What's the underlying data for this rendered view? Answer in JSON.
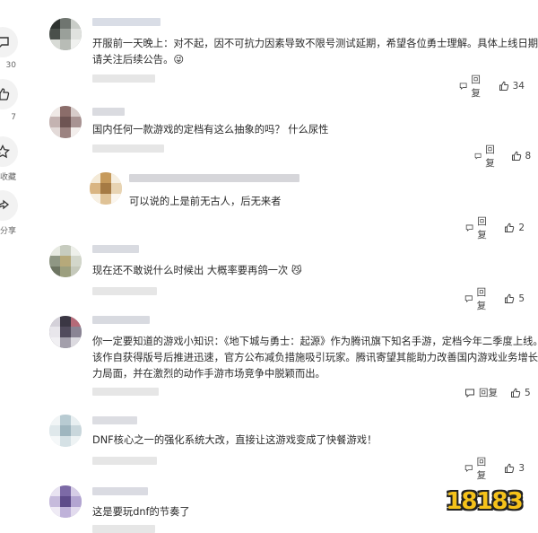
{
  "sidebar": {
    "comment": {
      "count": "30",
      "icon": "comment-icon"
    },
    "like": {
      "count": "7",
      "icon": "thumbs-up-icon"
    },
    "favorite": {
      "label": "收藏",
      "icon": "star-icon"
    },
    "share": {
      "label": "分享",
      "icon": "share-icon"
    }
  },
  "comments": [
    {
      "lines": [
        "开服前一天晚上：对不起，因不可抗力因素导致不限号测试延期，希望各位勇士理解。具体上线日期，",
        "请关注后续公告。😜"
      ],
      "reply_label": "回复",
      "likes": "34"
    },
    {
      "lines": [
        "国内任何一款游戏的定档有这么抽象的吗？ 什么尿性"
      ],
      "reply_label": "回复",
      "likes": "8"
    },
    {
      "lines": [
        "可以说的上是前无古人，后无来者"
      ],
      "reply_label": "回复",
      "likes": "2"
    },
    {
      "lines": [
        "现在还不敢说什么时候出 大概率要再鸽一次 😼"
      ],
      "reply_label": "回复",
      "likes": "5"
    },
    {
      "lines": [
        "你一定要知道的游戏小知识：《地下城与勇士：起源》作为腾讯旗下知名手游，定档今年二季度上线。",
        "该作自获得版号后推进迅速，官方公布减负措施吸引玩家。腾讯寄望其能助力改善国内游戏业务增长乏",
        "力局面，并在激烈的动作手游市场竞争中脱颖而出。"
      ],
      "reply_label": "回复",
      "likes": "5"
    },
    {
      "lines": [
        "DNF核心之一的强化系统大改，直接让这游戏变成了快餐游戏！"
      ],
      "reply_label": "回复",
      "likes": "3"
    },
    {
      "lines": [
        "这是要玩dnf的节奏了"
      ]
    }
  ],
  "watermark": {
    "text": "18183"
  },
  "colors": {
    "accent_logo": "#f5c21a",
    "text": "#2a2a2a",
    "muted": "#444444"
  }
}
